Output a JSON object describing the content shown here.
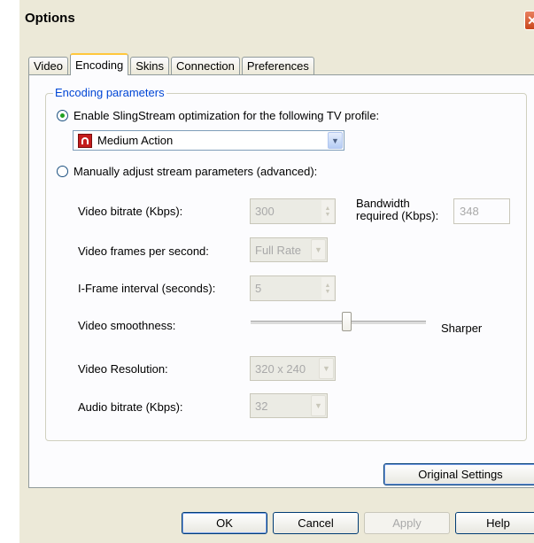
{
  "window": {
    "title": "Options",
    "close_glyph": "✕"
  },
  "tabs": [
    {
      "label": "Video"
    },
    {
      "label": "Encoding",
      "active": true
    },
    {
      "label": "Skins"
    },
    {
      "label": "Connection"
    },
    {
      "label": "Preferences"
    }
  ],
  "encoding": {
    "group_title": "Encoding parameters",
    "radio_slingstream_label": "Enable SlingStream optimization for the following TV profile:",
    "radio_slingstream_checked": true,
    "profile_value": "Medium Action",
    "radio_manual_label": "Manually adjust stream parameters (advanced):",
    "radio_manual_checked": false,
    "video_bitrate_label": "Video bitrate (Kbps):",
    "video_bitrate_value": "300",
    "bandwidth_label_line1": "Bandwidth",
    "bandwidth_label_line2": "required (Kbps):",
    "bandwidth_value": "348",
    "fps_label": "Video frames per second:",
    "fps_value": "Full Rate",
    "iframe_label": "I-Frame interval (seconds):",
    "iframe_value": "5",
    "smoothness_label": "Video smoothness:",
    "smoothness_right_label": "Sharper",
    "smoothness_level": 0.55,
    "resolution_label": "Video Resolution:",
    "resolution_value": "320 x 240",
    "audio_bitrate_label": "Audio bitrate (Kbps):",
    "audio_bitrate_value": "32"
  },
  "buttons": {
    "original_settings": "Original Settings",
    "ok": "OK",
    "cancel": "Cancel",
    "apply": "Apply",
    "help": "Help"
  },
  "colors": {
    "group_title": "#0046d5",
    "active_tab_accent": "#ffc73c",
    "close_button": "#c9461c",
    "radio_dot": "#21a121"
  }
}
